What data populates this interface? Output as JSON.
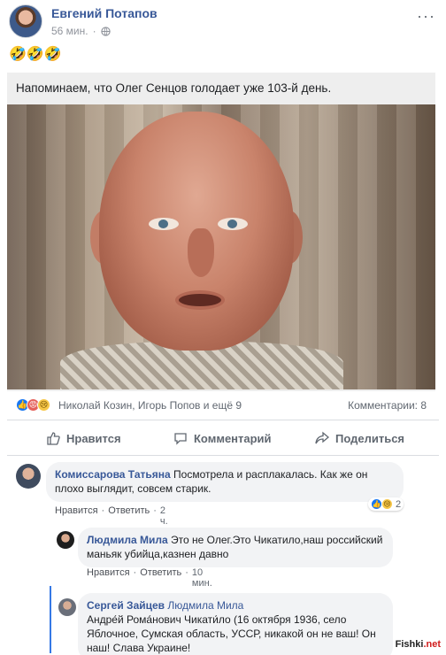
{
  "post": {
    "author": "Евгений Потапов",
    "time": "56 мин.",
    "emoji": "🤣🤣🤣",
    "card_text": "Напоминаем, что Олег Сенцов голодает уже 103-й день."
  },
  "reactions": {
    "names": "Николай Козин, Игорь Попов и ещё 9",
    "comments_count": "Комментарии: 8"
  },
  "actions": {
    "like": "Нравится",
    "comment": "Комментарий",
    "share": "Поделиться"
  },
  "comments": [
    {
      "name": "Комиссарова Татьяна",
      "text": "Посмотрела и расплакалась. Как же он плохо выглядит, совсем старик.",
      "like": "Нравится",
      "reply": "Ответить",
      "time": "2 ч.",
      "reaction_count": "2"
    },
    {
      "name": "Людмила Мила",
      "text": "Это не Олег.Это Чикатило,наш российский маньяк убийца,казнен давно",
      "like": "Нравится",
      "reply": "Ответить",
      "time": "10 мин."
    },
    {
      "name": "Сергей Зайцев",
      "mention": "Людмила Мила",
      "text": "Андре́й Рома́нович Чикати́ло (16 октября 1936, село Яблочное, Сумская область, УССР, никакой он не ваш! Он наш! Слава Украине!"
    }
  ],
  "watermark": {
    "part1": "Fishki",
    "part2": ".net"
  },
  "colors": {
    "link": "#385898",
    "accent": "#1877f2",
    "muted": "#606770",
    "bubble": "#f2f3f5"
  }
}
